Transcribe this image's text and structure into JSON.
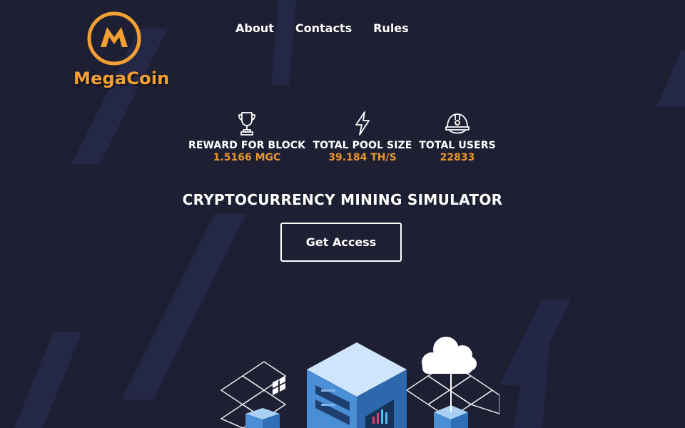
{
  "brand": {
    "name": "MegaCoin",
    "logo_letter": "M",
    "color": "#f2a033"
  },
  "nav": {
    "items": [
      {
        "label": "About"
      },
      {
        "label": "Contacts"
      },
      {
        "label": "Rules"
      }
    ]
  },
  "stats": [
    {
      "icon": "trophy-icon",
      "label": "REWARD FOR BLOCK",
      "value": "1.5166 MGC"
    },
    {
      "icon": "lightning-icon",
      "label": "TOTAL POOL SIZE",
      "value": "39.184 TH/S"
    },
    {
      "icon": "miner-helmet-icon",
      "label": "TOTAL USERS",
      "value": "22833"
    }
  ],
  "hero": {
    "headline": "CRYPTOCURRENCY MINING SIMULATOR",
    "cta_label": "Get Access"
  },
  "colors": {
    "background": "#1e1f33",
    "accent": "#e8952f",
    "text": "#ffffff",
    "server_blue": "#4a8fd6"
  }
}
